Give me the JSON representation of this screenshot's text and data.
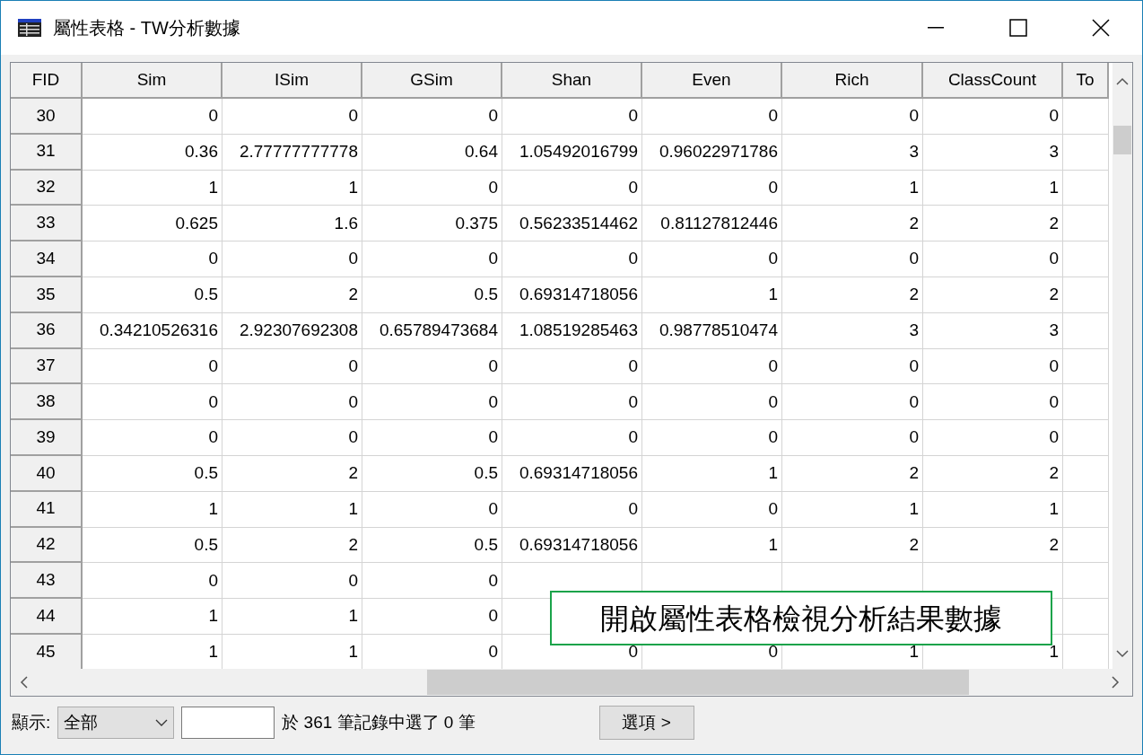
{
  "window": {
    "title": "屬性表格 - TW分析數據"
  },
  "table": {
    "columns": [
      "FID",
      "Sim",
      "ISim",
      "GSim",
      "Shan",
      "Even",
      "Rich",
      "ClassCount",
      "To"
    ],
    "rows": [
      [
        "30",
        "0",
        "0",
        "0",
        "0",
        "0",
        "0",
        "0"
      ],
      [
        "31",
        "0.36",
        "2.77777777778",
        "0.64",
        "1.05492016799",
        "0.96022971786",
        "3",
        "3"
      ],
      [
        "32",
        "1",
        "1",
        "0",
        "0",
        "0",
        "1",
        "1"
      ],
      [
        "33",
        "0.625",
        "1.6",
        "0.375",
        "0.56233514462",
        "0.81127812446",
        "2",
        "2"
      ],
      [
        "34",
        "0",
        "0",
        "0",
        "0",
        "0",
        "0",
        "0"
      ],
      [
        "35",
        "0.5",
        "2",
        "0.5",
        "0.69314718056",
        "1",
        "2",
        "2"
      ],
      [
        "36",
        "0.34210526316",
        "2.92307692308",
        "0.65789473684",
        "1.08519285463",
        "0.98778510474",
        "3",
        "3"
      ],
      [
        "37",
        "0",
        "0",
        "0",
        "0",
        "0",
        "0",
        "0"
      ],
      [
        "38",
        "0",
        "0",
        "0",
        "0",
        "0",
        "0",
        "0"
      ],
      [
        "39",
        "0",
        "0",
        "0",
        "0",
        "0",
        "0",
        "0"
      ],
      [
        "40",
        "0.5",
        "2",
        "0.5",
        "0.69314718056",
        "1",
        "2",
        "2"
      ],
      [
        "41",
        "1",
        "1",
        "0",
        "0",
        "0",
        "1",
        "1"
      ],
      [
        "42",
        "0.5",
        "2",
        "0.5",
        "0.69314718056",
        "1",
        "2",
        "2"
      ],
      [
        "43",
        "0",
        "0",
        "0",
        null,
        null,
        null,
        null
      ],
      [
        "44",
        "1",
        "1",
        "0",
        null,
        null,
        null,
        null
      ],
      [
        "45",
        "1",
        "1",
        "0",
        "0",
        "0",
        "1",
        "1"
      ]
    ]
  },
  "callout": {
    "text": "開啟屬性表格檢視分析結果數據"
  },
  "footer": {
    "show_label": "顯示:",
    "filter": {
      "value": "全部"
    },
    "status": "於 361 筆記錄中選了 0 筆",
    "options_button": "選項 >"
  }
}
